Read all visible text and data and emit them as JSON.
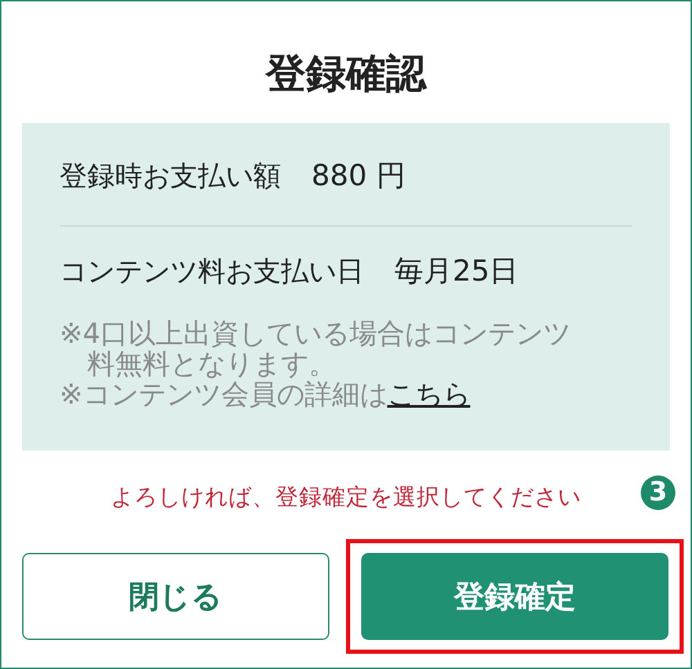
{
  "title": "登録確認",
  "rows": [
    {
      "label": "登録時お支払い額",
      "value": "880 円"
    },
    {
      "label": "コンテンツ料お支払い日",
      "value": "毎月25日"
    }
  ],
  "notes": [
    {
      "text": "※4口以上出資している場合はコンテンツ料無料となります。"
    },
    {
      "text": "※コンテンツ会員の詳細は",
      "link": "こちら"
    }
  ],
  "instruction": "よろしければ、登録確定を選択してください",
  "step_badge": "3",
  "buttons": [
    {
      "label": "閉じる",
      "kind": "secondary",
      "highlighted": false
    },
    {
      "label": "登録確定",
      "kind": "primary",
      "highlighted": true
    }
  ]
}
